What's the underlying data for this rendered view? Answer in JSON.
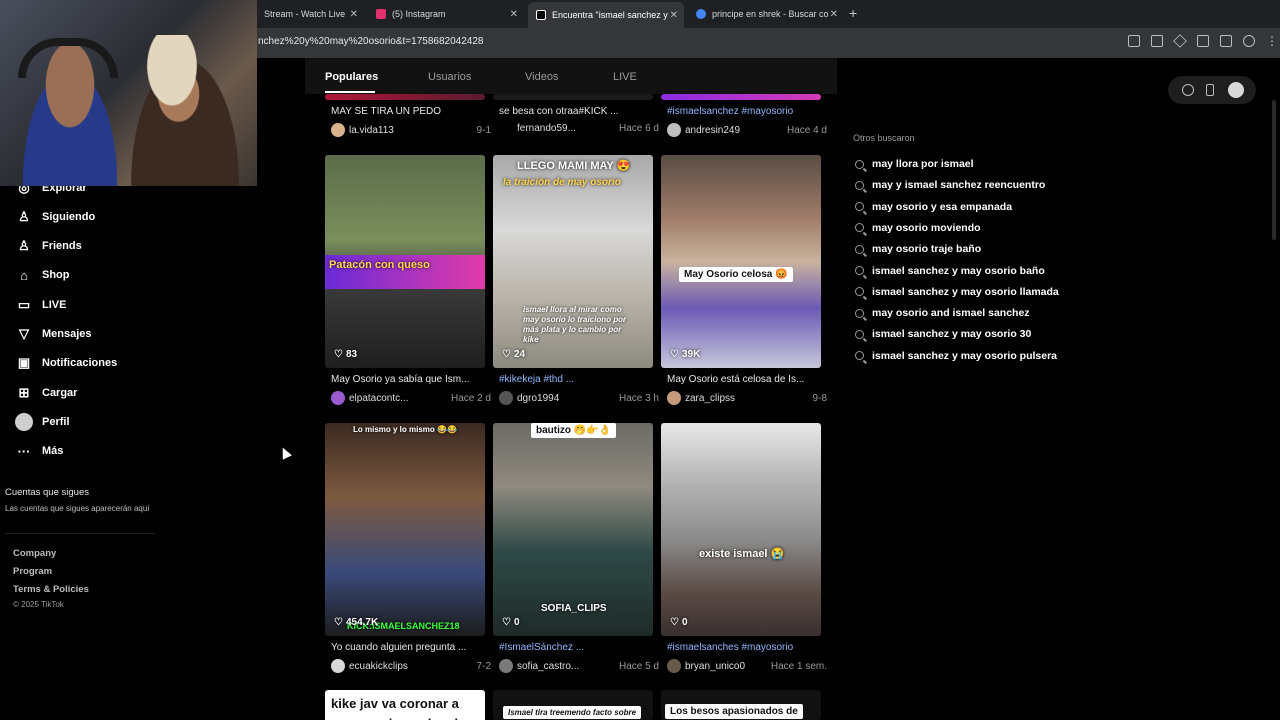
{
  "browser": {
    "tabs": [
      {
        "label": "Stream - Watch Live",
        "favicon_color": "#6441a5"
      },
      {
        "label": "(5) Instagram",
        "favicon_color": "#e1306c"
      },
      {
        "label": "Encuentra \"ismael sanchez y",
        "favicon_color": "#000000"
      },
      {
        "label": "principe en shrek - Buscar co",
        "favicon_color": "#4285f4"
      }
    ],
    "new_tab": "+",
    "url": "nchez%20y%20may%20osorio&t=1758682042428"
  },
  "search_tabs": [
    "Populares",
    "Usuarios",
    "Videos",
    "LIVE"
  ],
  "sidebar": {
    "items": [
      {
        "label": "Explorar",
        "icon": "compass-icon",
        "glyph": "◎"
      },
      {
        "label": "Siguiendo",
        "icon": "following-icon",
        "glyph": "♙"
      },
      {
        "label": "Friends",
        "icon": "friends-icon",
        "glyph": "♙"
      },
      {
        "label": "Shop",
        "icon": "shop-icon",
        "glyph": "⌂"
      },
      {
        "label": "LIVE",
        "icon": "live-icon",
        "glyph": "▭"
      },
      {
        "label": "Mensajes",
        "icon": "messages-icon",
        "glyph": "▽"
      },
      {
        "label": "Notificaciones",
        "icon": "notifications-icon",
        "glyph": "▣"
      },
      {
        "label": "Cargar",
        "icon": "upload-icon",
        "glyph": "⊞"
      },
      {
        "label": "Perfil",
        "icon": "profile-avatar",
        "glyph": ""
      },
      {
        "label": "Más",
        "icon": "more-icon",
        "glyph": "···"
      }
    ],
    "following_title": "Cuentas que sigues",
    "following_note": "Las cuentas que sigues aparecerán aquí",
    "footer_links": [
      "Company",
      "Program",
      "Terms & Policies"
    ],
    "copyright": "© 2025 TikTok"
  },
  "top_row": [
    {
      "caption": "MAY SE TIRA UN PEDO",
      "user": "la.vida113",
      "time": "9-1",
      "tag": false
    },
    {
      "caption": "se besa con otraa#KICK ...",
      "user": "fernando59...",
      "time": "Hace 6 d",
      "tag": false
    },
    {
      "caption": "#ismaelsanchez #mayosorio",
      "user": "andresin249",
      "time": "Hace 4 d",
      "tag": true
    }
  ],
  "mid_row": [
    {
      "overlay": "Patacón con queso",
      "likes": "83",
      "caption": "May Osorio ya sabía que Ism...",
      "user": "elpatacontc...",
      "time": "Hace 2 d",
      "tag": false
    },
    {
      "overlay": "LLEGO MAMI MAY 😍",
      "overlay2": "la traición de may osorio",
      "overlay3": "ismael llora al mirar como may osorio lo traiciono por más plata y lo cambio por kike",
      "likes": "24",
      "caption": "#kikekeja #thd ...",
      "user": "dgro1994",
      "time": "Hace 3 h",
      "tag": true
    },
    {
      "overlay": "May Osorio celosa 😡",
      "likes": "39K",
      "caption": "May Osorio está celosa de Is...",
      "user": "zara_clipss",
      "time": "9-8",
      "tag": false
    }
  ],
  "bottom_row": [
    {
      "overlay": "Lo mismo y lo mismo 😂😂",
      "overlay2": "KICK:ISMAELSANCHEZ18",
      "likes": "454.7K",
      "caption": "Yo cuando alguien pregunta ...",
      "user": "ecuakickclips",
      "time": "7-2",
      "tag": false
    },
    {
      "overlay": "bautizo 🤭👉👌",
      "overlay2": "SOFIA_CLIPS",
      "likes": "0",
      "caption": "#IsmaelSánchez ...",
      "user": "sofia_castro...",
      "time": "Hace 5 d",
      "tag": true
    },
    {
      "overlay": "existe ismael 😭",
      "likes": "0",
      "caption": "#ismaelsanches #mayosorio",
      "user": "bryan_unico0",
      "time": "Hace 1 sem.",
      "tag": true
    }
  ],
  "peek_row": [
    {
      "overlay": "kike jav va coronar a may osorio un dos de"
    },
    {
      "overlay": "Ismael tira treemendo facto sobre"
    },
    {
      "overlay": "Los besos apasionados de"
    }
  ],
  "others": {
    "title": "Otros buscaron",
    "items": [
      "may llora por ismael",
      "may y ismael sanchez reencuentro",
      "may osorio y esa empanada",
      "may osorio moviendo",
      "may osorio traje baño",
      "ismael sanchez y may osorio baño",
      "ismael sanchez y may osorio llamada",
      "may osorio and ismael sanchez",
      "ismael sanchez y may osorio 30",
      "ismael sanchez y may osorio pulsera"
    ]
  },
  "colors": {
    "background": "#000000",
    "hashtag": "#8fb8ff",
    "chrome": "#35363a",
    "tabbar": "#1f2023"
  }
}
